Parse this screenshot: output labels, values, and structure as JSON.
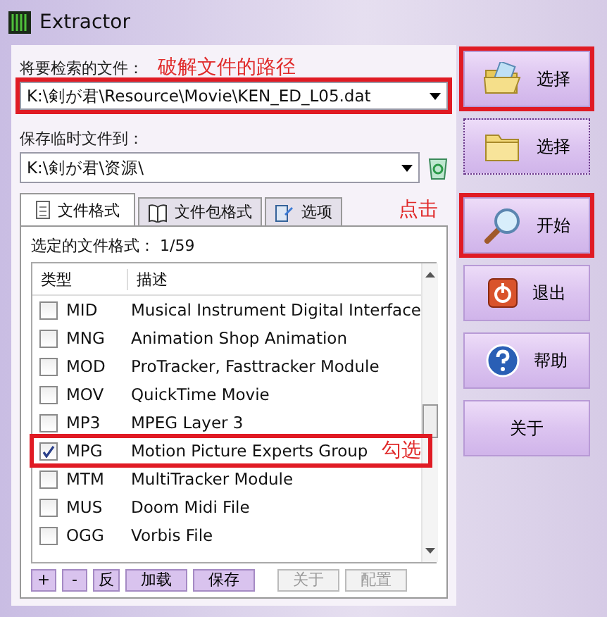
{
  "window": {
    "title": "Extractor"
  },
  "source": {
    "label": "将要检索的文件：",
    "note": "破解文件的路径",
    "value": "K:\\剣が君\\Resource\\Movie\\KEN_ED_L05.dat",
    "highlighted": true
  },
  "temp": {
    "label": "保存临时文件到：",
    "value": "K:\\剣が君\\资源\\"
  },
  "tabs": [
    {
      "label": "文件格式",
      "selected": true
    },
    {
      "label": "文件包格式",
      "selected": false
    },
    {
      "label": "选项",
      "selected": false
    }
  ],
  "selected_formats": "选定的文件格式： 1/59",
  "table": {
    "columns": [
      "类型",
      "描述"
    ],
    "rows": [
      {
        "type": "MID",
        "description": "Musical Instrument Digital Interface",
        "checked": false,
        "highlighted": false
      },
      {
        "type": "MNG",
        "description": "Animation Shop Animation",
        "checked": false,
        "highlighted": false
      },
      {
        "type": "MOD",
        "description": "ProTracker, Fasttracker Module",
        "checked": false,
        "highlighted": false
      },
      {
        "type": "MOV",
        "description": "QuickTime Movie",
        "checked": false,
        "highlighted": false
      },
      {
        "type": "MP3",
        "description": "MPEG Layer 3",
        "checked": false,
        "highlighted": false
      },
      {
        "type": "MPG",
        "description": "Motion Picture Experts Group",
        "checked": true,
        "highlighted": true,
        "note": "勾选"
      },
      {
        "type": "MTM",
        "description": "MultiTracker Module",
        "checked": false,
        "highlighted": false
      },
      {
        "type": "MUS",
        "description": "Doom Midi File",
        "checked": false,
        "highlighted": false
      },
      {
        "type": "OGG",
        "description": "Vorbis File",
        "checked": false,
        "highlighted": false
      }
    ]
  },
  "list_buttons": [
    {
      "label": "+",
      "disabled": false
    },
    {
      "label": "-",
      "disabled": false
    },
    {
      "label": "反",
      "disabled": false
    },
    {
      "label": "加载",
      "disabled": false
    },
    {
      "label": "保存",
      "disabled": false
    },
    {
      "label": "关于",
      "disabled": true
    },
    {
      "label": "配置",
      "disabled": true
    }
  ],
  "side_buttons": [
    {
      "label": "选择",
      "highlighted": true,
      "focused": false
    },
    {
      "label": "选择",
      "highlighted": false,
      "focused": true
    },
    {
      "label": "开始",
      "highlighted": true,
      "focused": false,
      "note": "点击"
    },
    {
      "label": "退出",
      "highlighted": false,
      "focused": false
    },
    {
      "label": "帮助",
      "highlighted": false,
      "focused": false
    },
    {
      "label": "关于",
      "highlighted": false,
      "focused": false
    }
  ]
}
